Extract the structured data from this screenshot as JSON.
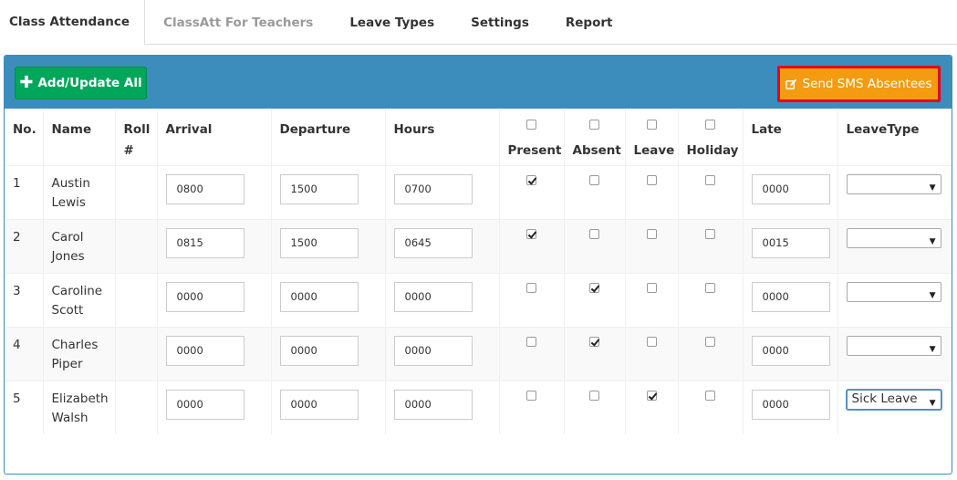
{
  "tabs": [
    {
      "label": "Class Attendance"
    },
    {
      "label": "ClassAtt For Teachers"
    },
    {
      "label": "Leave Types"
    },
    {
      "label": "Settings"
    },
    {
      "label": "Report"
    }
  ],
  "toolbar": {
    "add_label": "Add/Update All",
    "sms_label": "Send SMS Absentees"
  },
  "colors": {
    "header_blue": "#3c8dbc",
    "add_green": "#00a65a",
    "sms_orange": "#f39c12",
    "sms_border_red": "#e8001c"
  },
  "table": {
    "headers": {
      "no": "No.",
      "name": "Name",
      "roll": "Roll #",
      "arrival": "Arrival",
      "departure": "Departure",
      "hours": "Hours",
      "present": "Present",
      "absent": "Absent",
      "leave": "Leave",
      "holiday": "Holiday",
      "late": "Late",
      "leavetype": "LeaveType"
    },
    "rows": [
      {
        "no": "1",
        "name": "Austin Lewis",
        "roll": "",
        "arrival": "0800",
        "departure": "1500",
        "hours": "0700",
        "present": true,
        "absent": false,
        "leave": false,
        "holiday": false,
        "late": "0000",
        "leavetype": ""
      },
      {
        "no": "2",
        "name": "Carol Jones",
        "roll": "",
        "arrival": "0815",
        "departure": "1500",
        "hours": "0645",
        "present": true,
        "absent": false,
        "leave": false,
        "holiday": false,
        "late": "0015",
        "leavetype": ""
      },
      {
        "no": "3",
        "name": "Caroline Scott",
        "roll": "",
        "arrival": "0000",
        "departure": "0000",
        "hours": "0000",
        "present": false,
        "absent": true,
        "leave": false,
        "holiday": false,
        "late": "0000",
        "leavetype": ""
      },
      {
        "no": "4",
        "name": "Charles Piper",
        "roll": "",
        "arrival": "0000",
        "departure": "0000",
        "hours": "0000",
        "present": false,
        "absent": true,
        "leave": false,
        "holiday": false,
        "late": "0000",
        "leavetype": ""
      },
      {
        "no": "5",
        "name": "Elizabeth Walsh",
        "roll": "",
        "arrival": "0000",
        "departure": "0000",
        "hours": "0000",
        "present": false,
        "absent": false,
        "leave": true,
        "holiday": false,
        "late": "0000",
        "leavetype": "Sick Leave"
      }
    ]
  }
}
